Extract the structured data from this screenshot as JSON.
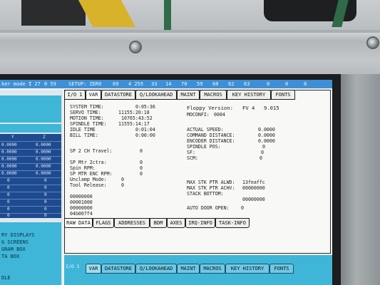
{
  "status_bar": {
    "items": [
      "ker mode 1",
      "T 27",
      "0 59",
      "SETUP: ZERO",
      "69",
      "4 255",
      "33",
      "14",
      "70",
      "59",
      "60",
      "62",
      "63",
      "0",
      "0",
      "0"
    ]
  },
  "top_tabs": [
    "I/O 1",
    "VAR",
    "DATASTORE",
    "Q/LOOKAHEAD",
    "MAINT",
    "MACROS",
    "KEY HISTORY",
    "FONTS"
  ],
  "left_col": {
    "table_header": [
      "Y",
      "Z"
    ],
    "table_rows": [
      [
        "0.0000",
        "0.0000"
      ],
      [
        "0.0000",
        "0.0000"
      ],
      [
        "0.0000",
        "0.0000"
      ],
      [
        "0.0000",
        "0.0000"
      ],
      [
        "0.0000",
        "0.0000"
      ],
      [
        "0",
        "0"
      ],
      [
        "0",
        "0"
      ],
      [
        "0",
        "0"
      ],
      [
        "0",
        "0"
      ],
      [
        "0",
        "0"
      ],
      [
        "0",
        "0"
      ]
    ],
    "bottom_items": [
      "RY DISPLAYS",
      "G SCREENS",
      "GRAM BOX",
      "TA BOX",
      "DLE"
    ]
  },
  "times": [
    {
      "label": "SYSTEM TIME:",
      "value": "0:05:36"
    },
    {
      "label": "SERVO TIME:",
      "value": "11155:20:18"
    },
    {
      "label": "MOTION TIME:",
      "value": "10765:43:52"
    },
    {
      "label": "SPINDLE TIME:",
      "value": "11555:14:17"
    },
    {
      "label": "IDLE TIME",
      "value": "0:01:04"
    },
    {
      "label": "BILL TIME:",
      "value": "0:00:00"
    }
  ],
  "sp2": {
    "label": "SP 2 CH Travel:",
    "value": "0"
  },
  "spindle_info": [
    {
      "label": "SP Mtr 2ctra:",
      "value": "0"
    },
    {
      "label": "Spin RPM:",
      "value": "0"
    },
    {
      "label": "SP MTR ENC RPM:",
      "value": "0"
    },
    {
      "label": "Unclamp Mode:",
      "value": "0"
    },
    {
      "label": "Tool Release:",
      "value": "0"
    }
  ],
  "hex_values": [
    "00000000",
    "00001000",
    "00000000",
    "04b007f4"
  ],
  "floppy": {
    "label": "Floppy Version:",
    "fv": "FV 4",
    "value": "9.015"
  },
  "moconfig": {
    "label": "MOCONFI:",
    "value": "0004"
  },
  "speeds": [
    {
      "label": "ACTUAL SPEED:",
      "value": "0.0000"
    },
    {
      "label": "COMMAND DISTANCE:",
      "value": "0.0000"
    },
    {
      "label": "ENCODER DISTANCE:",
      "value": "0.0000"
    },
    {
      "label": "SPINDLE POS:",
      "value": "0"
    },
    {
      "label": "SF:",
      "value": "0"
    },
    {
      "label": "SCM:",
      "value": "0"
    }
  ],
  "stack": [
    {
      "label": "MAX STK PTR ALWD:",
      "value": "13feaffc"
    },
    {
      "label": "MAX STK PTR ACHV:",
      "value": "00000000"
    },
    {
      "label": "STACK BOTTOM:",
      "value": "00000000"
    }
  ],
  "auto_door": {
    "label": "AUTO DOOR OPEN:",
    "value": "0"
  },
  "bottom_tabs": [
    "RAW DATA",
    "FLAGS",
    "ADDRESSES",
    "BDM",
    "AXES",
    "IRQ-INFO",
    "TASK-INFO"
  ],
  "lower_prefix": "I/O 1",
  "lower_tabs": [
    "VAR",
    "DATASTORE",
    "Q/LOOKAHEAD",
    "MAINT",
    "MACROS",
    "KEY HISTORY",
    "FONTS"
  ]
}
